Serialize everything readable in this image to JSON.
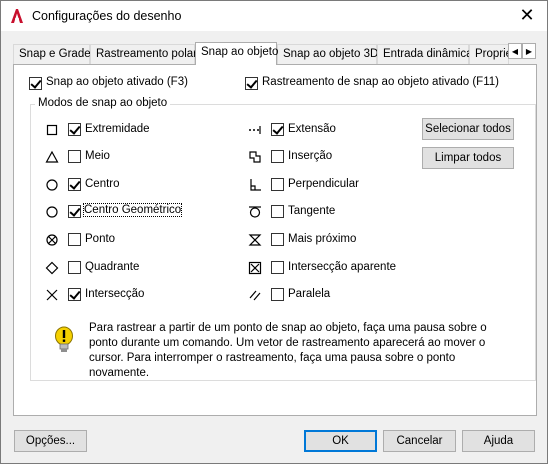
{
  "window": {
    "title": "Configurações do desenho",
    "close_glyph": "✕"
  },
  "tabs": [
    {
      "label": "Snap e Grade",
      "active": false
    },
    {
      "label": "Rastreamento polar",
      "active": false
    },
    {
      "label": "Snap ao objeto",
      "active": true
    },
    {
      "label": "Snap ao objeto 3D",
      "active": false
    },
    {
      "label": "Entrada dinâmica",
      "active": false
    },
    {
      "label": "Proprie",
      "active": false
    }
  ],
  "tab_scroll": {
    "left": "◀",
    "right": "▶"
  },
  "options": {
    "snap_on": {
      "label": "Snap ao objeto ativado (F3)",
      "checked": true
    },
    "tracking_on": {
      "label": "Rastreamento de snap ao objeto ativado (F11)",
      "checked": true
    }
  },
  "group": {
    "title": "Modos de snap ao objeto"
  },
  "modes_left": [
    {
      "label": "Extremidade",
      "checked": true,
      "icon": "square-icon"
    },
    {
      "label": "Meio",
      "checked": false,
      "icon": "triangle-icon"
    },
    {
      "label": "Centro",
      "checked": true,
      "icon": "circle-icon"
    },
    {
      "label": "Centro Geométrico",
      "checked": true,
      "icon": "circle-icon"
    },
    {
      "label": "Ponto",
      "checked": false,
      "icon": "node-icon"
    },
    {
      "label": "Quadrante",
      "checked": false,
      "icon": "diamond-icon"
    },
    {
      "label": "Intersecção",
      "checked": true,
      "icon": "x-icon"
    }
  ],
  "modes_right": [
    {
      "label": "Extensão",
      "checked": true,
      "icon": "extension-icon"
    },
    {
      "label": "Inserção",
      "checked": false,
      "icon": "insertion-icon"
    },
    {
      "label": "Perpendicular",
      "checked": false,
      "icon": "perpendicular-icon"
    },
    {
      "label": "Tangente",
      "checked": false,
      "icon": "tangent-icon"
    },
    {
      "label": "Mais próximo",
      "checked": false,
      "icon": "hourglass-icon"
    },
    {
      "label": "Intersecção aparente",
      "checked": false,
      "icon": "boxed-x-icon"
    },
    {
      "label": "Paralela",
      "checked": false,
      "icon": "parallel-icon"
    }
  ],
  "buttons": {
    "select_all": "Selecionar todos",
    "clear_all": "Limpar todos",
    "options": "Opções...",
    "ok": "OK",
    "cancel": "Cancelar",
    "help": "Ajuda"
  },
  "info_text": "Para rastrear a partir de um ponto de snap ao objeto, faça uma pausa sobre o ponto durante um comando. Um vetor de rastreamento aparecerá ao mover o cursor. Para interromper o rastreamento, faça uma pausa sobre o ponto novamente.",
  "colors": {
    "accent": "#0078d7",
    "app_icon": "#c8102e",
    "info_bulb": "#f5d000"
  }
}
